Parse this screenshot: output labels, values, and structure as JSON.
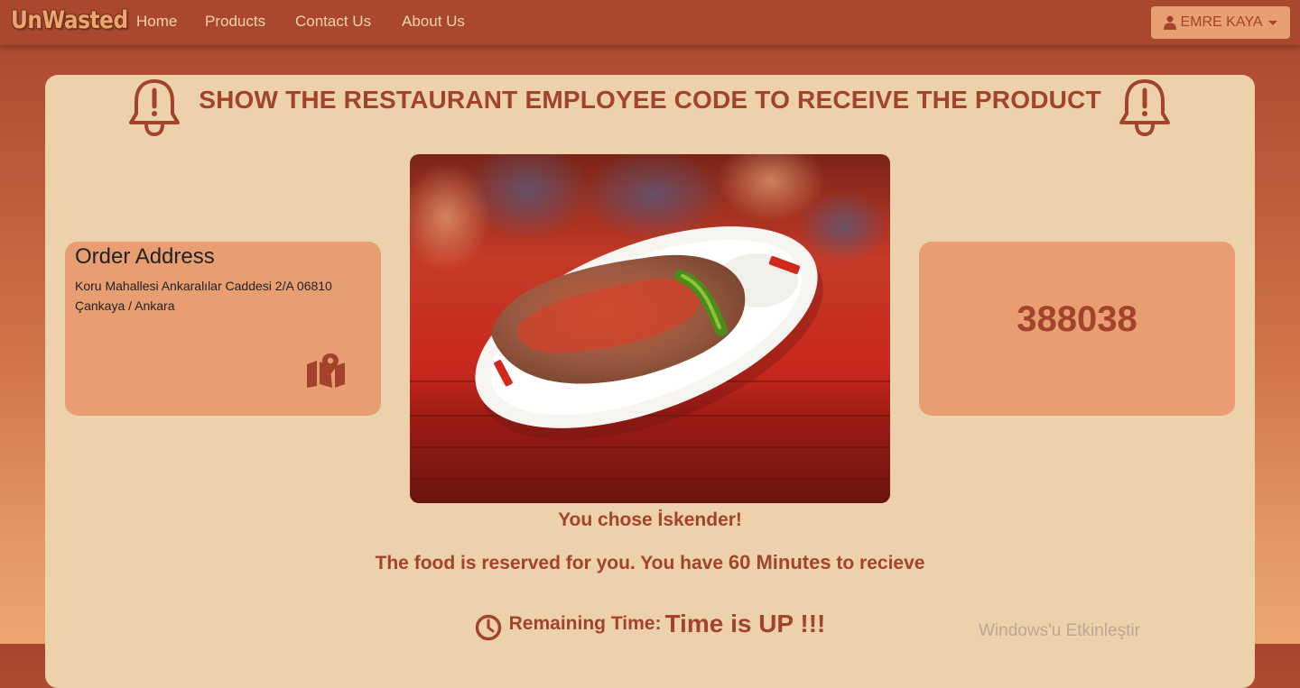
{
  "navbar": {
    "brand": "UnWasted",
    "links": [
      "Home",
      "Products",
      "Contact Us",
      "About Us"
    ],
    "user_name": "EMRE KAYA",
    "user_icon": "user-icon"
  },
  "notice": {
    "heading": "SHOW THE RESTAURANT EMPLOYEE CODE TO RECEIVE THE PRODUCT",
    "icon": "bell-exclamation-icon"
  },
  "address_card": {
    "title": "Order Address",
    "line1": "Koru Mahallesi Ankaralılar Caddesi 2/A 06810",
    "line2": "Çankaya / Ankara",
    "icon": "map-icon"
  },
  "employee_code": "388038",
  "food": {
    "image": "iskender-plate-photo",
    "chosen_text": "You chose İskender!",
    "reserved_prefix": "The food is reserved for you. You have ",
    "reserved_minutes": "60 Minutes",
    "reserved_suffix": " to recieve"
  },
  "timer": {
    "label": "Remaining Time:",
    "value": "Time is UP !!!",
    "icon": "clock-icon"
  },
  "watermark": "Windows'u Etkinleştir",
  "colors": {
    "brand_red": "#a3432b",
    "card_bg": "#edd1ab",
    "box_bg": "#e89e71",
    "navbar_bg": "#a9482f"
  }
}
